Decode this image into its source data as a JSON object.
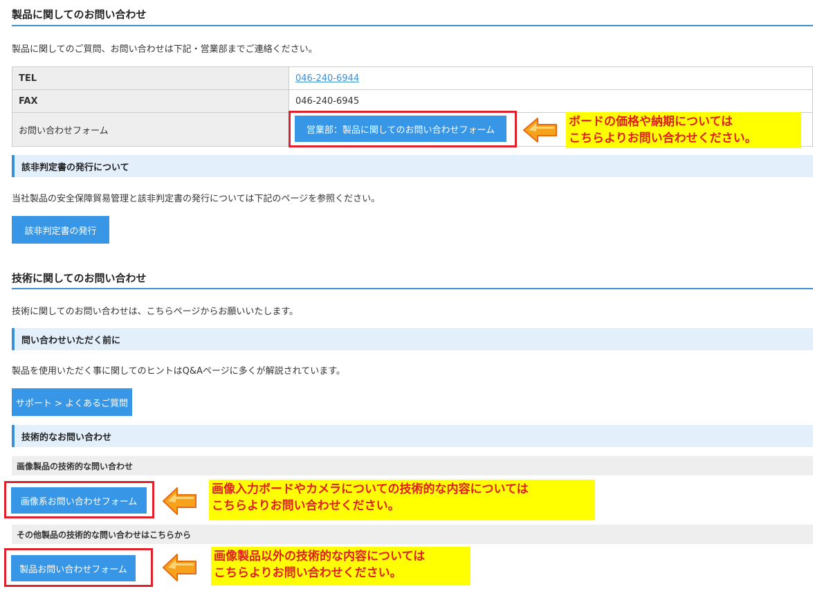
{
  "product_section": {
    "title": "製品に関してのお問い合わせ",
    "description": "製品に関してのご質問、お問い合わせは下記・営業部までご連絡ください。",
    "table": {
      "tel_label": "TEL",
      "tel_value": "046-240-6944",
      "fax_label": "FAX",
      "fax_value": "046-240-6945",
      "form_label": "お問い合わせフォーム",
      "form_button": "営業部：製品に関してのお問い合わせフォーム"
    },
    "note": [
      "ボードの価格や納期については",
      "こちらよりお問い合わせください。"
    ]
  },
  "export_section": {
    "title": "該非判定書の発行について",
    "description": "当社製品の安全保障貿易管理と該非判定書の発行については下記のページを参照ください。",
    "button": "該非判定書の発行"
  },
  "tech_section": {
    "title": "技術に関してのお問い合わせ",
    "description": "技術に関してのお問い合わせは、こちらページからお願いいたします。",
    "before": {
      "title": "問い合わせいただく前に",
      "description": "製品を使用いただく事に関してのヒントはQ&Aページに多くが解説されています。",
      "button": "サポート > よくあるご質問"
    },
    "technical": {
      "title": "技術的なお問い合わせ",
      "image_products": {
        "title": "画像製品の技術的な問い合わせ",
        "button": "画像系お問い合わせフォーム",
        "note": [
          "画像入力ボードやカメラについての技術的な内容については",
          "こちらよりお問い合わせください。"
        ]
      },
      "other_products": {
        "title": "その他製品の技術的な問い合わせはこちらから",
        "button": "製品お問い合わせフォーム",
        "note": [
          "画像製品以外の技術的な内容については",
          "こちらよりお問い合わせください。"
        ]
      }
    }
  },
  "colors": {
    "accent_blue": "#3896e6",
    "heading_line": "#3a8fd6",
    "highlight_red": "#e0202a",
    "note_yellow": "#ffff00",
    "arrow_orange": "#f7a21b"
  },
  "icons": {
    "arrow": "left-arrow-icon"
  }
}
